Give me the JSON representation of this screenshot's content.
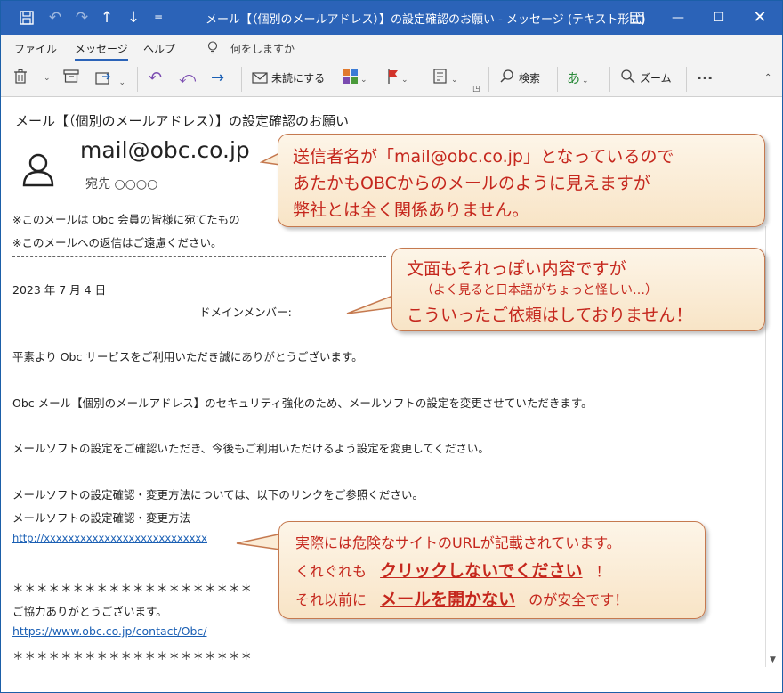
{
  "window": {
    "title": "メール【（個別のメールアドレス）】の設定確認のお願い  -  メッセージ (テキスト形式)"
  },
  "titlebar_icons": {
    "save": "save-icon",
    "undo": "undo-icon",
    "redo": "redo-icon",
    "up": "arrow-up-icon",
    "down": "arrow-down-icon",
    "customize": "customize-quick-access-icon"
  },
  "menu": {
    "file": "ファイル",
    "message": "メッセージ",
    "help": "ヘルプ",
    "tell_me": "何をしますか"
  },
  "toolbar": {
    "mark_unread": "未読にする",
    "search": "検索",
    "zoom": "ズーム",
    "more": "···"
  },
  "email": {
    "subject": "メール【（個別のメールアドレス）】の設定確認のお願い",
    "sender": "mail@obc.co.jp",
    "to": "宛先 ○○○○",
    "body": [
      "※このメールは Obc 会員の皆様に宛てたもの",
      "※このメールへの返信はご遠慮ください。",
      "2023 年 7 月 4 日",
      "ドメインメンバー:",
      "平素より Obc サービスをご利用いただき誠にありがとうございます。",
      "Obc メール【個別のメールアドレス】のセキュリティ強化のため、メールソフトの設定を変更させていただきます。",
      "メールソフトの設定をご確認いただき、今後もご利用いただけるよう設定を変更してください。",
      "メールソフトの設定確認・変更方法については、以下のリンクをご参照ください。",
      "メールソフトの設定確認・変更方法",
      "http://xxxxxxxxxxxxxxxxxxxxxxxxxxx",
      "＊＊＊＊＊＊＊＊＊＊＊＊＊＊＊＊＊＊＊＊",
      "ご協力ありがとうございます。",
      "https://www.obc.co.jp/contact/Obc/",
      "＊＊＊＊＊＊＊＊＊＊＊＊＊＊＊＊＊＊＊＊"
    ]
  },
  "callouts": {
    "sender_note": [
      "送信者名が「mail@obc.co.jp」となっているので",
      "あたかもOBCからのメールのように見えますが",
      "弊社とは全く関係ありません。"
    ],
    "content_note": [
      "文面もそれっぽい内容ですが",
      "（よく見ると日本語がちょっと怪しい…）",
      "こういったご依頼はしておりません！"
    ],
    "link_note": {
      "line1": "実際には危険なサイトのURLが記載されています。",
      "line2_pre": "くれぐれも",
      "line2_emph": "クリックしないでください",
      "line2_post": "！",
      "line3_pre": "それ以前に",
      "line3_emph": "メールを開かない",
      "line3_post": "のが安全です！"
    }
  },
  "colors": {
    "titlebar": "#2b63b8",
    "callout_text": "#c5271d",
    "callout_border": "#c5794f",
    "link": "#1a5fb4"
  }
}
